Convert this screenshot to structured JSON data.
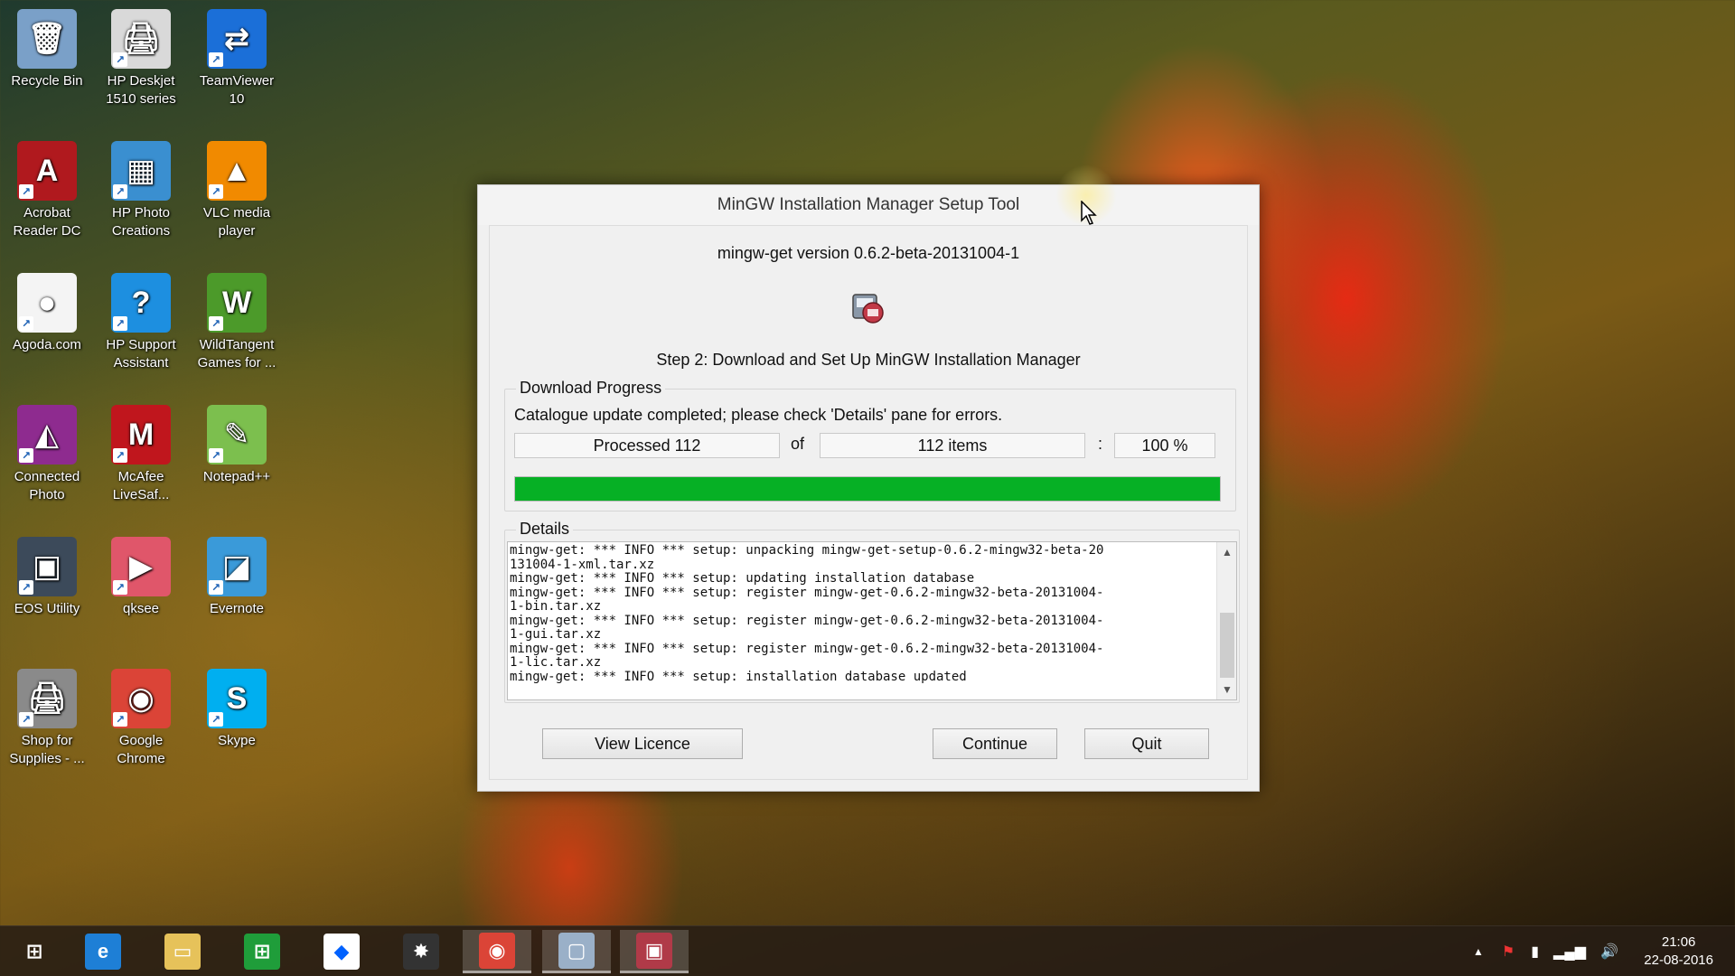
{
  "desktop": {
    "icons": [
      {
        "label": "Recycle Bin",
        "glyph": "🗑",
        "color": "#7aa0c8"
      },
      {
        "label": "HP Deskjet 1510 series",
        "glyph": "🖨",
        "color": "#d9d9d9"
      },
      {
        "label": "TeamViewer 10",
        "glyph": "⇄",
        "color": "#1b6fd8"
      },
      {
        "label": "Acrobat Reader DC",
        "glyph": "A",
        "color": "#b0191e"
      },
      {
        "label": "HP Photo Creations",
        "glyph": "▦",
        "color": "#3a8fd0"
      },
      {
        "label": "VLC media player",
        "glyph": "▲",
        "color": "#f18a00"
      },
      {
        "label": "Agoda.com",
        "glyph": "●",
        "color": "#f4f4f4"
      },
      {
        "label": "HP Support Assistant",
        "glyph": "?",
        "color": "#1d8fe0"
      },
      {
        "label": "WildTangent Games for ...",
        "glyph": "W",
        "color": "#4c9a2a"
      },
      {
        "label": "Connected Photo",
        "glyph": "◭",
        "color": "#8e2b8f"
      },
      {
        "label": "McAfee LiveSaf...",
        "glyph": "M",
        "color": "#c0161d"
      },
      {
        "label": "Notepad++",
        "glyph": "✎",
        "color": "#7cbf4e"
      },
      {
        "label": "EOS Utility",
        "glyph": "▣",
        "color": "#3c4a5a"
      },
      {
        "label": "qksee",
        "glyph": "▶",
        "color": "#e0566a"
      },
      {
        "label": "Evernote",
        "glyph": "◪",
        "color": "#3a9ad9"
      },
      {
        "label": "Shop for Supplies - ...",
        "glyph": "🖨",
        "color": "#8a8a8a"
      },
      {
        "label": "Google Chrome",
        "glyph": "◉",
        "color": "#db4437"
      },
      {
        "label": "Skype",
        "glyph": "S",
        "color": "#00aff0"
      }
    ]
  },
  "dialog": {
    "title": "MinGW Installation Manager Setup Tool",
    "version": "mingw-get version 0.6.2-beta-20131004-1",
    "step": "Step 2: Download and Set Up MinGW Installation Manager",
    "download_group_title": "Download Progress",
    "status": "Catalogue update completed; please check 'Details' pane for errors.",
    "processed": "Processed 112",
    "of": "of",
    "total": "112 items",
    "colon": ":",
    "percent": "100 %",
    "progress_fraction": 1.0,
    "progress_color": "#06b025",
    "details_group_title": "Details",
    "log_lines": [
      "mingw-get: *** INFO *** setup: unpacking mingw-get-setup-0.6.2-mingw32-beta-20",
      "131004-1-xml.tar.xz",
      "mingw-get: *** INFO *** setup: updating installation database",
      "mingw-get: *** INFO *** setup: register mingw-get-0.6.2-mingw32-beta-20131004-",
      "1-bin.tar.xz",
      "mingw-get: *** INFO *** setup: register mingw-get-0.6.2-mingw32-beta-20131004-",
      "1-gui.tar.xz",
      "mingw-get: *** INFO *** setup: register mingw-get-0.6.2-mingw32-beta-20131004-",
      "1-lic.tar.xz",
      "mingw-get: *** INFO *** setup: installation database updated"
    ],
    "buttons": {
      "view_licence": "View Licence",
      "continue": "Continue",
      "quit": "Quit"
    }
  },
  "taskbar": {
    "items": [
      {
        "name": "start-button",
        "glyph": "⊞",
        "color": "transparent",
        "active": false
      },
      {
        "name": "taskbar-internet-explorer",
        "glyph": "e",
        "color": "#1e7fd6",
        "active": false
      },
      {
        "name": "taskbar-file-explorer",
        "glyph": "▭",
        "color": "#e6c25a",
        "active": false
      },
      {
        "name": "taskbar-store",
        "glyph": "⊞",
        "color": "#1f9d3a",
        "active": false
      },
      {
        "name": "taskbar-dropbox",
        "glyph": "◆",
        "color": "#ffffff",
        "active": false
      },
      {
        "name": "taskbar-photo-app",
        "glyph": "✸",
        "color": "#333333",
        "active": false
      },
      {
        "name": "taskbar-chrome",
        "glyph": "◉",
        "color": "#db4437",
        "active": true
      },
      {
        "name": "taskbar-window-app",
        "glyph": "▢",
        "color": "#9ab0c8",
        "active": true
      },
      {
        "name": "taskbar-mingw-setup",
        "glyph": "▣",
        "color": "#b03a48",
        "active": true
      }
    ],
    "clock_time": "21:06",
    "clock_date": "22-08-2016"
  }
}
